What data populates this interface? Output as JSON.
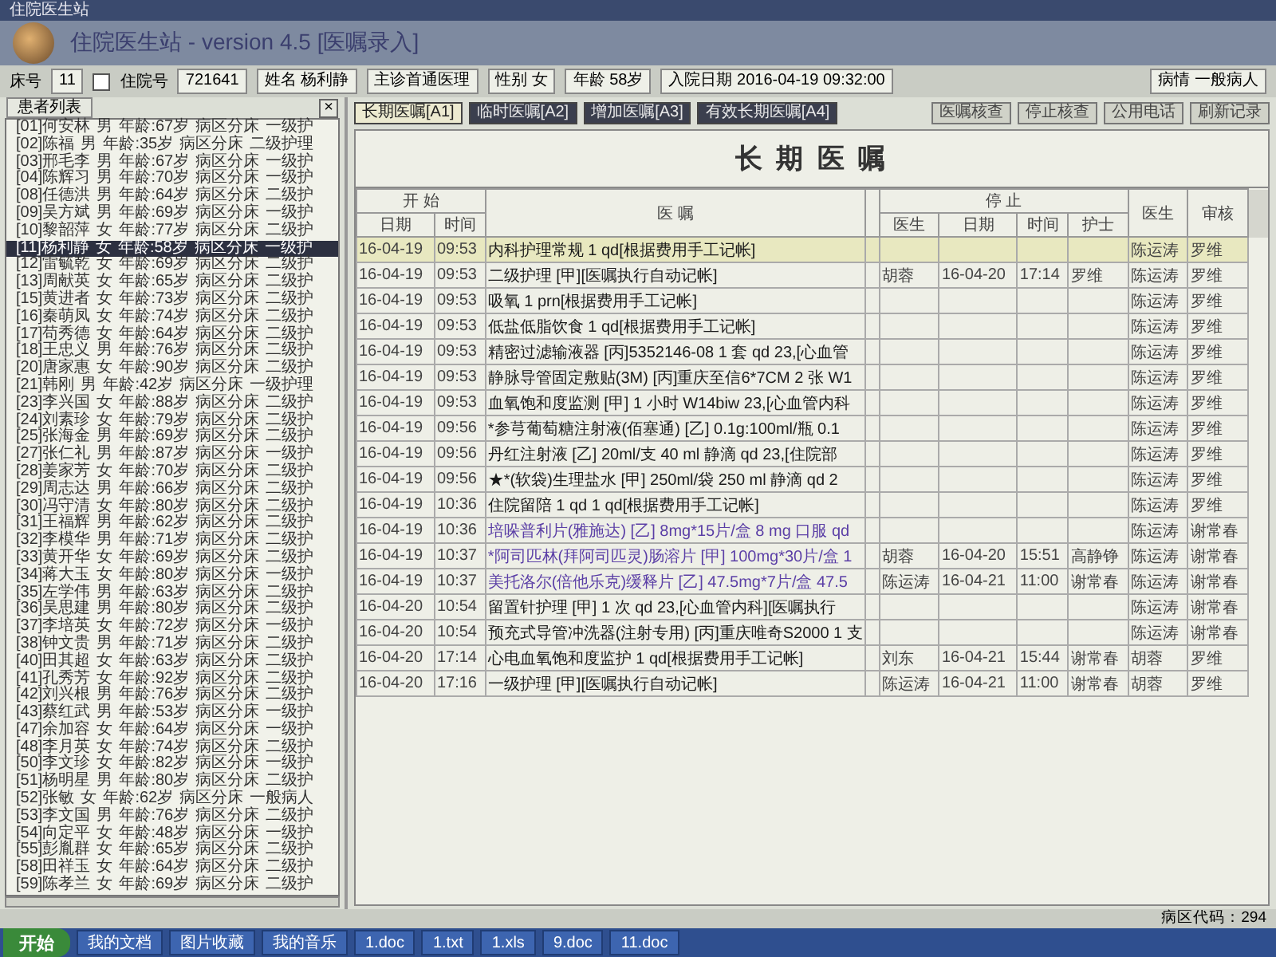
{
  "window": {
    "title": "住院医生站"
  },
  "app_title": "住院医生站 - version 4.5 [医嘱录入]",
  "patient_bar": {
    "bed_label": "床号",
    "bed": "11",
    "inpatient_checkbox": {
      "label": "住院号",
      "checked": false
    },
    "inpatient_no": "721641",
    "name": "姓名 杨利静",
    "doctor": "主诊首通医理",
    "sex": "性别 女",
    "age": "年龄 58岁",
    "admit": "入院日期 2016-04-19 09:32:00",
    "condition": "病情 一般病人"
  },
  "patient_list": {
    "title": "患者列表",
    "close": "×",
    "rows": [
      {
        "no": "[01]",
        "name": "何安林",
        "sex": "男",
        "age": "年龄:67岁",
        "ward": "病区分床",
        "care": "一级护",
        "selected": false
      },
      {
        "no": "[02]",
        "name": "陈福",
        "sex": "男",
        "age": "年龄:35岁",
        "ward": "病区分床",
        "care": "二级护理",
        "selected": false
      },
      {
        "no": "[03]",
        "name": "邢毛李",
        "sex": "男",
        "age": "年龄:67岁",
        "ward": "病区分床",
        "care": "一级护",
        "selected": false
      },
      {
        "no": "[04]",
        "name": "陈辉习",
        "sex": "男",
        "age": "年龄:70岁",
        "ward": "病区分床",
        "care": "一级护",
        "selected": false
      },
      {
        "no": "[08]",
        "name": "任德洪",
        "sex": "男",
        "age": "年龄:64岁",
        "ward": "病区分床",
        "care": "二级护",
        "selected": false
      },
      {
        "no": "[09]",
        "name": "吴方斌",
        "sex": "男",
        "age": "年龄:69岁",
        "ward": "病区分床",
        "care": "一级护",
        "selected": false
      },
      {
        "no": "[10]",
        "name": "黎韶萍",
        "sex": "女",
        "age": "年龄:77岁",
        "ward": "病区分床",
        "care": "二级护",
        "selected": false
      },
      {
        "no": "[11]",
        "name": "杨利静",
        "sex": "女",
        "age": "年龄:58岁",
        "ward": "病区分床",
        "care": "一级护",
        "selected": true
      },
      {
        "no": "[12]",
        "name": "雷毓乾",
        "sex": "女",
        "age": "年龄:69岁",
        "ward": "病区分床",
        "care": "二级护",
        "selected": false
      },
      {
        "no": "[13]",
        "name": "周献英",
        "sex": "女",
        "age": "年龄:65岁",
        "ward": "病区分床",
        "care": "二级护",
        "selected": false
      },
      {
        "no": "[15]",
        "name": "黄进者",
        "sex": "女",
        "age": "年龄:73岁",
        "ward": "病区分床",
        "care": "二级护",
        "selected": false
      },
      {
        "no": "[16]",
        "name": "秦萌凤",
        "sex": "女",
        "age": "年龄:74岁",
        "ward": "病区分床",
        "care": "二级护",
        "selected": false
      },
      {
        "no": "[17]",
        "name": "苟秀德",
        "sex": "女",
        "age": "年龄:64岁",
        "ward": "病区分床",
        "care": "二级护",
        "selected": false
      },
      {
        "no": "[18]",
        "name": "王忠义",
        "sex": "男",
        "age": "年龄:76岁",
        "ward": "病区分床",
        "care": "二级护",
        "selected": false
      },
      {
        "no": "[20]",
        "name": "唐家惠",
        "sex": "女",
        "age": "年龄:90岁",
        "ward": "病区分床",
        "care": "二级护",
        "selected": false
      },
      {
        "no": "[21]",
        "name": "韩刚",
        "sex": "男",
        "age": "年龄:42岁",
        "ward": "病区分床",
        "care": "一级护理",
        "selected": false
      },
      {
        "no": "[23]",
        "name": "李兴国",
        "sex": "女",
        "age": "年龄:88岁",
        "ward": "病区分床",
        "care": "二级护",
        "selected": false
      },
      {
        "no": "[24]",
        "name": "刘素珍",
        "sex": "女",
        "age": "年龄:79岁",
        "ward": "病区分床",
        "care": "二级护",
        "selected": false
      },
      {
        "no": "[25]",
        "name": "张海金",
        "sex": "男",
        "age": "年龄:69岁",
        "ward": "病区分床",
        "care": "二级护",
        "selected": false
      },
      {
        "no": "[27]",
        "name": "张仁礼",
        "sex": "男",
        "age": "年龄:87岁",
        "ward": "病区分床",
        "care": "一级护",
        "selected": false
      },
      {
        "no": "[28]",
        "name": "姜家芳",
        "sex": "女",
        "age": "年龄:70岁",
        "ward": "病区分床",
        "care": "二级护",
        "selected": false
      },
      {
        "no": "[29]",
        "name": "周志达",
        "sex": "男",
        "age": "年龄:66岁",
        "ward": "病区分床",
        "care": "二级护",
        "selected": false
      },
      {
        "no": "[30]",
        "name": "冯守清",
        "sex": "女",
        "age": "年龄:80岁",
        "ward": "病区分床",
        "care": "二级护",
        "selected": false
      },
      {
        "no": "[31]",
        "name": "王福辉",
        "sex": "男",
        "age": "年龄:62岁",
        "ward": "病区分床",
        "care": "二级护",
        "selected": false
      },
      {
        "no": "[32]",
        "name": "李模华",
        "sex": "男",
        "age": "年龄:71岁",
        "ward": "病区分床",
        "care": "二级护",
        "selected": false
      },
      {
        "no": "[33]",
        "name": "黄开华",
        "sex": "女",
        "age": "年龄:69岁",
        "ward": "病区分床",
        "care": "二级护",
        "selected": false
      },
      {
        "no": "[34]",
        "name": "蒋大玉",
        "sex": "女",
        "age": "年龄:80岁",
        "ward": "病区分床",
        "care": "一级护",
        "selected": false
      },
      {
        "no": "[35]",
        "name": "左学伟",
        "sex": "男",
        "age": "年龄:63岁",
        "ward": "病区分床",
        "care": "二级护",
        "selected": false
      },
      {
        "no": "[36]",
        "name": "吴思建",
        "sex": "男",
        "age": "年龄:80岁",
        "ward": "病区分床",
        "care": "二级护",
        "selected": false
      },
      {
        "no": "[37]",
        "name": "李培英",
        "sex": "女",
        "age": "年龄:72岁",
        "ward": "病区分床",
        "care": "一级护",
        "selected": false
      },
      {
        "no": "[38]",
        "name": "钟文贵",
        "sex": "男",
        "age": "年龄:71岁",
        "ward": "病区分床",
        "care": "二级护",
        "selected": false
      },
      {
        "no": "[40]",
        "name": "田其超",
        "sex": "女",
        "age": "年龄:63岁",
        "ward": "病区分床",
        "care": "二级护",
        "selected": false
      },
      {
        "no": "[41]",
        "name": "孔秀芳",
        "sex": "女",
        "age": "年龄:92岁",
        "ward": "病区分床",
        "care": "二级护",
        "selected": false
      },
      {
        "no": "[42]",
        "name": "刘兴根",
        "sex": "男",
        "age": "年龄:76岁",
        "ward": "病区分床",
        "care": "二级护",
        "selected": false
      },
      {
        "no": "[43]",
        "name": "蔡红武",
        "sex": "男",
        "age": "年龄:53岁",
        "ward": "病区分床",
        "care": "一级护",
        "selected": false
      },
      {
        "no": "[47]",
        "name": "余加容",
        "sex": "女",
        "age": "年龄:64岁",
        "ward": "病区分床",
        "care": "一级护",
        "selected": false
      },
      {
        "no": "[48]",
        "name": "李月英",
        "sex": "女",
        "age": "年龄:74岁",
        "ward": "病区分床",
        "care": "二级护",
        "selected": false
      },
      {
        "no": "[50]",
        "name": "李文珍",
        "sex": "女",
        "age": "年龄:82岁",
        "ward": "病区分床",
        "care": "一级护",
        "selected": false
      },
      {
        "no": "[51]",
        "name": "杨明星",
        "sex": "男",
        "age": "年龄:80岁",
        "ward": "病区分床",
        "care": "二级护",
        "selected": false
      },
      {
        "no": "[52]",
        "name": "张敏",
        "sex": "女",
        "age": "年龄:62岁",
        "ward": "病区分床",
        "care": "一般病人",
        "selected": false
      },
      {
        "no": "[53]",
        "name": "李文国",
        "sex": "男",
        "age": "年龄:76岁",
        "ward": "病区分床",
        "care": "二级护",
        "selected": false
      },
      {
        "no": "[54]",
        "name": "向定平",
        "sex": "女",
        "age": "年龄:48岁",
        "ward": "病区分床",
        "care": "一级护",
        "selected": false
      },
      {
        "no": "[55]",
        "name": "彭胤群",
        "sex": "女",
        "age": "年龄:65岁",
        "ward": "病区分床",
        "care": "二级护",
        "selected": false
      },
      {
        "no": "[58]",
        "name": "田祥玉",
        "sex": "女",
        "age": "年龄:64岁",
        "ward": "病区分床",
        "care": "二级护",
        "selected": false
      },
      {
        "no": "[59]",
        "name": "陈孝兰",
        "sex": "女",
        "age": "年龄:69岁",
        "ward": "病区分床",
        "care": "二级护",
        "selected": false
      }
    ]
  },
  "tabs": [
    {
      "label": "长期医嘱[A1]",
      "selected": true
    },
    {
      "label": "临时医嘱[A2]",
      "selected": false
    },
    {
      "label": "增加医嘱[A3]",
      "selected": false
    },
    {
      "label": "有效长期医嘱[A4]",
      "selected": false
    }
  ],
  "actions": [
    "医嘱核查",
    "停止核查",
    "公用电话",
    "刷新记录"
  ],
  "sheet": {
    "title": "长 期 医 嘱",
    "headers": {
      "start": "开 始",
      "date": "日期",
      "time": "时间",
      "order": "医 嘱",
      "stop": "停 止",
      "stop_doctor": "医生",
      "stop_date": "日期",
      "stop_time": "时间",
      "nurse": "护士",
      "doctor": "医生",
      "audit": "审核"
    },
    "rows": [
      {
        "date": "16-04-19",
        "time": "09:53",
        "order": "内科护理常规 1 qd[根据费用手工记帐]",
        "color": "#1a1a1a",
        "doctor": "陈运涛",
        "audit": "罗维",
        "selected": true
      },
      {
        "date": "16-04-19",
        "time": "09:53",
        "order": "二级护理 [甲][医嘱执行自动记帐]",
        "color": "#1a1a1a",
        "stop_doctor": "胡蓉",
        "stop_date": "16-04-20",
        "stop_time": "17:14",
        "nurse": "罗维",
        "doctor": "陈运涛",
        "audit": "罗维",
        "selected": false
      },
      {
        "date": "16-04-19",
        "time": "09:53",
        "order": "吸氧 1 prn[根据费用手工记帐]",
        "color": "#1a1a1a",
        "doctor": "陈运涛",
        "audit": "罗维",
        "selected": false
      },
      {
        "date": "16-04-19",
        "time": "09:53",
        "order": "低盐低脂饮食 1 qd[根据费用手工记帐]",
        "color": "#1a1a1a",
        "doctor": "陈运涛",
        "audit": "罗维",
        "selected": false
      },
      {
        "date": "16-04-19",
        "time": "09:53",
        "order": "精密过滤输液器 [丙]5352146-08 1 套 qd 23,[心血管",
        "color": "#1a1a1a",
        "doctor": "陈运涛",
        "audit": "罗维",
        "selected": false
      },
      {
        "date": "16-04-19",
        "time": "09:53",
        "order": "静脉导管固定敷贴(3M) [丙]重庆至信6*7CM 2 张 W1",
        "color": "#1a1a1a",
        "doctor": "陈运涛",
        "audit": "罗维",
        "selected": false
      },
      {
        "date": "16-04-19",
        "time": "09:53",
        "order": "血氧饱和度监测 [甲] 1 小时 W14biw 23,[心血管内科",
        "color": "#1a1a1a",
        "doctor": "陈运涛",
        "audit": "罗维",
        "selected": false
      },
      {
        "date": "16-04-19",
        "time": "09:56",
        "order": "*参芎葡萄糖注射液(佰塞通) [乙] 0.1g:100ml/瓶 0.1",
        "color": "#1a1a1a",
        "doctor": "陈运涛",
        "audit": "罗维",
        "selected": false
      },
      {
        "date": "16-04-19",
        "time": "09:56",
        "order": "丹红注射液 [乙] 20ml/支 40 ml 静滴 qd 23,[住院部",
        "color": "#1a1a1a",
        "doctor": "陈运涛",
        "audit": "罗维",
        "selected": false
      },
      {
        "date": "16-04-19",
        "time": "09:56",
        "order": "★*(软袋)生理盐水 [甲] 250ml/袋 250 ml 静滴 qd 2",
        "color": "#1a1a1a",
        "doctor": "陈运涛",
        "audit": "罗维",
        "selected": false
      },
      {
        "date": "16-04-19",
        "time": "10:36",
        "order": "住院留陪 1 qd 1 qd[根据费用手工记帐]",
        "color": "#1a1a1a",
        "doctor": "陈运涛",
        "audit": "罗维",
        "selected": false
      },
      {
        "date": "16-04-19",
        "time": "10:36",
        "order": "培哚普利片(雅施达) [乙] 8mg*15片/盒 8 mg 口服 qd",
        "color": "#5b3fa6",
        "doctor": "陈运涛",
        "audit": "谢常春",
        "selected": false
      },
      {
        "date": "16-04-19",
        "time": "10:37",
        "order": "*阿司匹林(拜阿司匹灵)肠溶片 [甲] 100mg*30片/盒 1",
        "color": "#5b3fa6",
        "stop_doctor": "胡蓉",
        "stop_date": "16-04-20",
        "stop_time": "15:51",
        "nurse": "高静铮",
        "doctor": "陈运涛",
        "audit": "谢常春",
        "selected": false
      },
      {
        "date": "16-04-19",
        "time": "10:37",
        "order": "美托洛尔(倍他乐克)缓释片 [乙] 47.5mg*7片/盒 47.5",
        "color": "#5b3fa6",
        "stop_doctor": "陈运涛",
        "stop_date": "16-04-21",
        "stop_time": "11:00",
        "nurse": "谢常春",
        "doctor": "陈运涛",
        "audit": "谢常春",
        "selected": false
      },
      {
        "date": "16-04-20",
        "time": "10:54",
        "order": "留置针护理 [甲] 1 次 qd 23,[心血管内科][医嘱执行",
        "color": "#1a1a1a",
        "doctor": "陈运涛",
        "audit": "谢常春",
        "selected": false
      },
      {
        "date": "16-04-20",
        "time": "10:54",
        "order": "预充式导管冲洗器(注射专用) [丙]重庆唯奇S2000 1 支",
        "color": "#1a1a1a",
        "doctor": "陈运涛",
        "audit": "谢常春",
        "selected": false
      },
      {
        "date": "16-04-20",
        "time": "17:14",
        "order": "心电血氧饱和度监护 1 qd[根据费用手工记帐]",
        "color": "#1a1a1a",
        "stop_doctor": "刘东",
        "stop_date": "16-04-21",
        "stop_time": "15:44",
        "nurse": "谢常春",
        "doctor": "胡蓉",
        "audit": "罗维",
        "selected": false
      },
      {
        "date": "16-04-20",
        "time": "17:16",
        "order": "一级护理 [甲][医嘱执行自动记帐]",
        "color": "#1a1a1a",
        "stop_doctor": "陈运涛",
        "stop_date": "16-04-21",
        "stop_time": "11:00",
        "nurse": "谢常春",
        "doctor": "胡蓉",
        "audit": "罗维",
        "selected": false
      }
    ]
  },
  "status_bar": {
    "ward_code": "病区代码：294"
  },
  "taskbar": {
    "start": "开始",
    "items": [
      "我的文档",
      "图片收藏",
      "我的音乐",
      "1.doc",
      "1.txt",
      "1.xls",
      "9.doc",
      "11.doc"
    ]
  }
}
